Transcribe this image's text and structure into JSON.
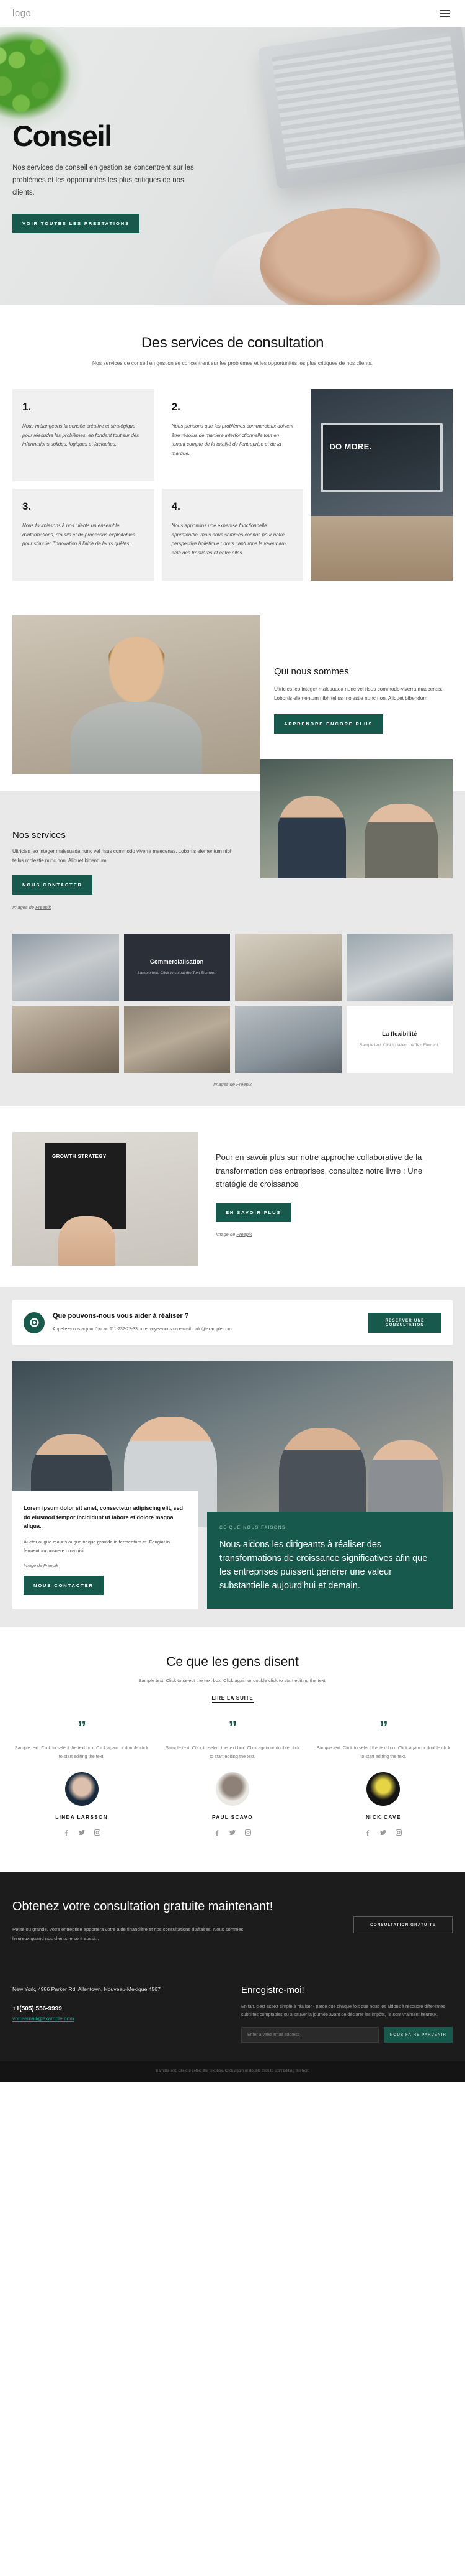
{
  "header": {
    "logo": "logo",
    "menu_icon": "hamburger-menu-icon"
  },
  "hero": {
    "title": "Conseil",
    "subtitle": "Nos services de conseil en gestion se concentrent sur les problèmes et les opportunités les plus critiques de nos clients.",
    "cta": "VOIR TOUTES LES PRESTATIONS"
  },
  "services": {
    "title": "Des services de consultation",
    "subtitle": "Nos services de conseil en gestion se concentrent sur les problèmes et les opportunités les plus critiques de nos clients.",
    "cards": [
      {
        "num": "1.",
        "text": "Nous mélangeons la pensée créative et stratégique pour résoudre les problèmes, en fondant tout sur des informations solides, logiques et factuelles."
      },
      {
        "num": "2.",
        "text": "Nous pensons que les problèmes commerciaux doivent être résolus de manière interfonctionnelle tout en tenant compte de la totalité de l'entreprise et de la marque."
      },
      {
        "num": "3.",
        "text": "Nous fournissons à nos clients un ensemble d'informations, d'outils et de processus exploitables pour stimuler l'innovation à l'aide de leurs quêtes."
      },
      {
        "num": "4.",
        "text": "Nous apportons une expertise fonctionnelle approfondie, mais nous sommes connus pour notre perspective holistique : nous capturons la valeur au-delà des frontières et entre elles."
      }
    ],
    "photo_caption": "DO MORE."
  },
  "about": {
    "title": "Qui nous sommes",
    "body": "Ultricies leo integer malesuada nunc vel risus commodo viverra maecenas. Lobortis elementum nibh tellus molestie nunc non. Aliquet bibendum",
    "cta": "APPRENDRE ENCORE PLUS"
  },
  "our_services": {
    "title": "Nos services",
    "body": "Ultricies leo integer malesuada nunc vel risus commodo viverra maecenas. Lobortis elementum nibh tellus molestie nunc non. Aliquet bibendum",
    "cta": "NOUS CONTACTER",
    "credit_prefix": "Images de ",
    "credit_link": "Freepik"
  },
  "portfolio": {
    "tiles": [
      {
        "title": "Commercialisation",
        "text": "Sample text. Click to select the Text Element."
      },
      {
        "title": "La flexibilité",
        "text": "Sample text. Click to select the Text Element."
      }
    ],
    "credit_prefix": "Images de ",
    "credit_link": "Freepik"
  },
  "book": {
    "cover_title": "GROWTH STRATEGY",
    "lead": "Pour en savoir plus sur notre approche collaborative de la transformation des entreprises, consultez notre livre : Une stratégie de croissance",
    "cta": "EN SAVOIR PLUS",
    "credit_prefix": "Image de ",
    "credit_link": "Freepik"
  },
  "help": {
    "icon": "lifebuoy-icon",
    "title": "Que pouvons-nous vous aider à réaliser ?",
    "subtitle": "Appellez-nous aujourd'hui au 111-232-22-33 ou envoyez-nous un e-mail : info@example.com",
    "cta": "RÉSERVER UNE CONSULTATION"
  },
  "mission": {
    "card_head": "Lorem ipsum dolor sit amet, consectetur adipiscing elit, sed do eiusmod tempor incididunt ut labore et dolore magna aliqua.",
    "card_body": "Auctor augue mauris augue neque gravida in fermentum et. Feugiat in fermentum posuere urna nisi.",
    "credit_prefix": "Image de ",
    "credit_link": "Freepik",
    "cta": "NOUS CONTACTER",
    "panel_eyebrow": "CE QUE NOUS FAISONS",
    "panel_text": "Nous aidons les dirigeants à réaliser des transformations de croissance significatives afin que les entreprises puissent générer une valeur substantielle aujourd'hui et demain."
  },
  "testimonials": {
    "title": "Ce que les gens disent",
    "subtitle": "Sample text. Click to select the text box. Click again or double click to start editing the text.",
    "link": "LIRE LA SUITE",
    "items": [
      {
        "quote": "Sample text. Click to select the text box. Click again or double click to start editing the text.",
        "name": "LINDA LARSSON"
      },
      {
        "quote": "Sample text. Click to select the text box. Click again or double click to start editing the text.",
        "name": "PAUL SCAVO"
      },
      {
        "quote": "Sample text. Click to select the text box. Click again or double click to start editing the text.",
        "name": "NICK CAVE"
      }
    ],
    "social_icons": [
      "facebook-icon",
      "twitter-icon",
      "instagram-icon"
    ]
  },
  "cta": {
    "title": "Obtenez votre consultation gratuite maintenant!",
    "body": "Petite ou grande, votre entreprise apportera votre aide financière et nos consultations d'affaires! Nous sommes heureux quand nos clients le sont aussi...",
    "button": "CONSULTATION GRATUITE"
  },
  "footer": {
    "address": "New York, 4986 Parker Rd. Allentown, Nouveau-Mexique 4567",
    "phone": "+1(505) 556-9999",
    "email": "votreemail@example.com",
    "signup_title": "Enregistre-moi!",
    "signup_note": "En fait, c'est assez simple à réaliser - parce que chaque fois que nous les aidons à résoudre différentes subtilités comptables ou à sauver la journée avant de déclarer les impôts, ils sont vraiment heureux.",
    "email_placeholder": "Enter a valid email address",
    "submit": "NOUS FAIRE PARVENIR"
  },
  "bottom": {
    "line1": "Sample text. Click to select the text box. Click again or double click to start editing the text."
  },
  "colors": {
    "brand_green": "#17594c",
    "dark": "#1c1c1c",
    "grey_bg": "#e9e9e9"
  }
}
